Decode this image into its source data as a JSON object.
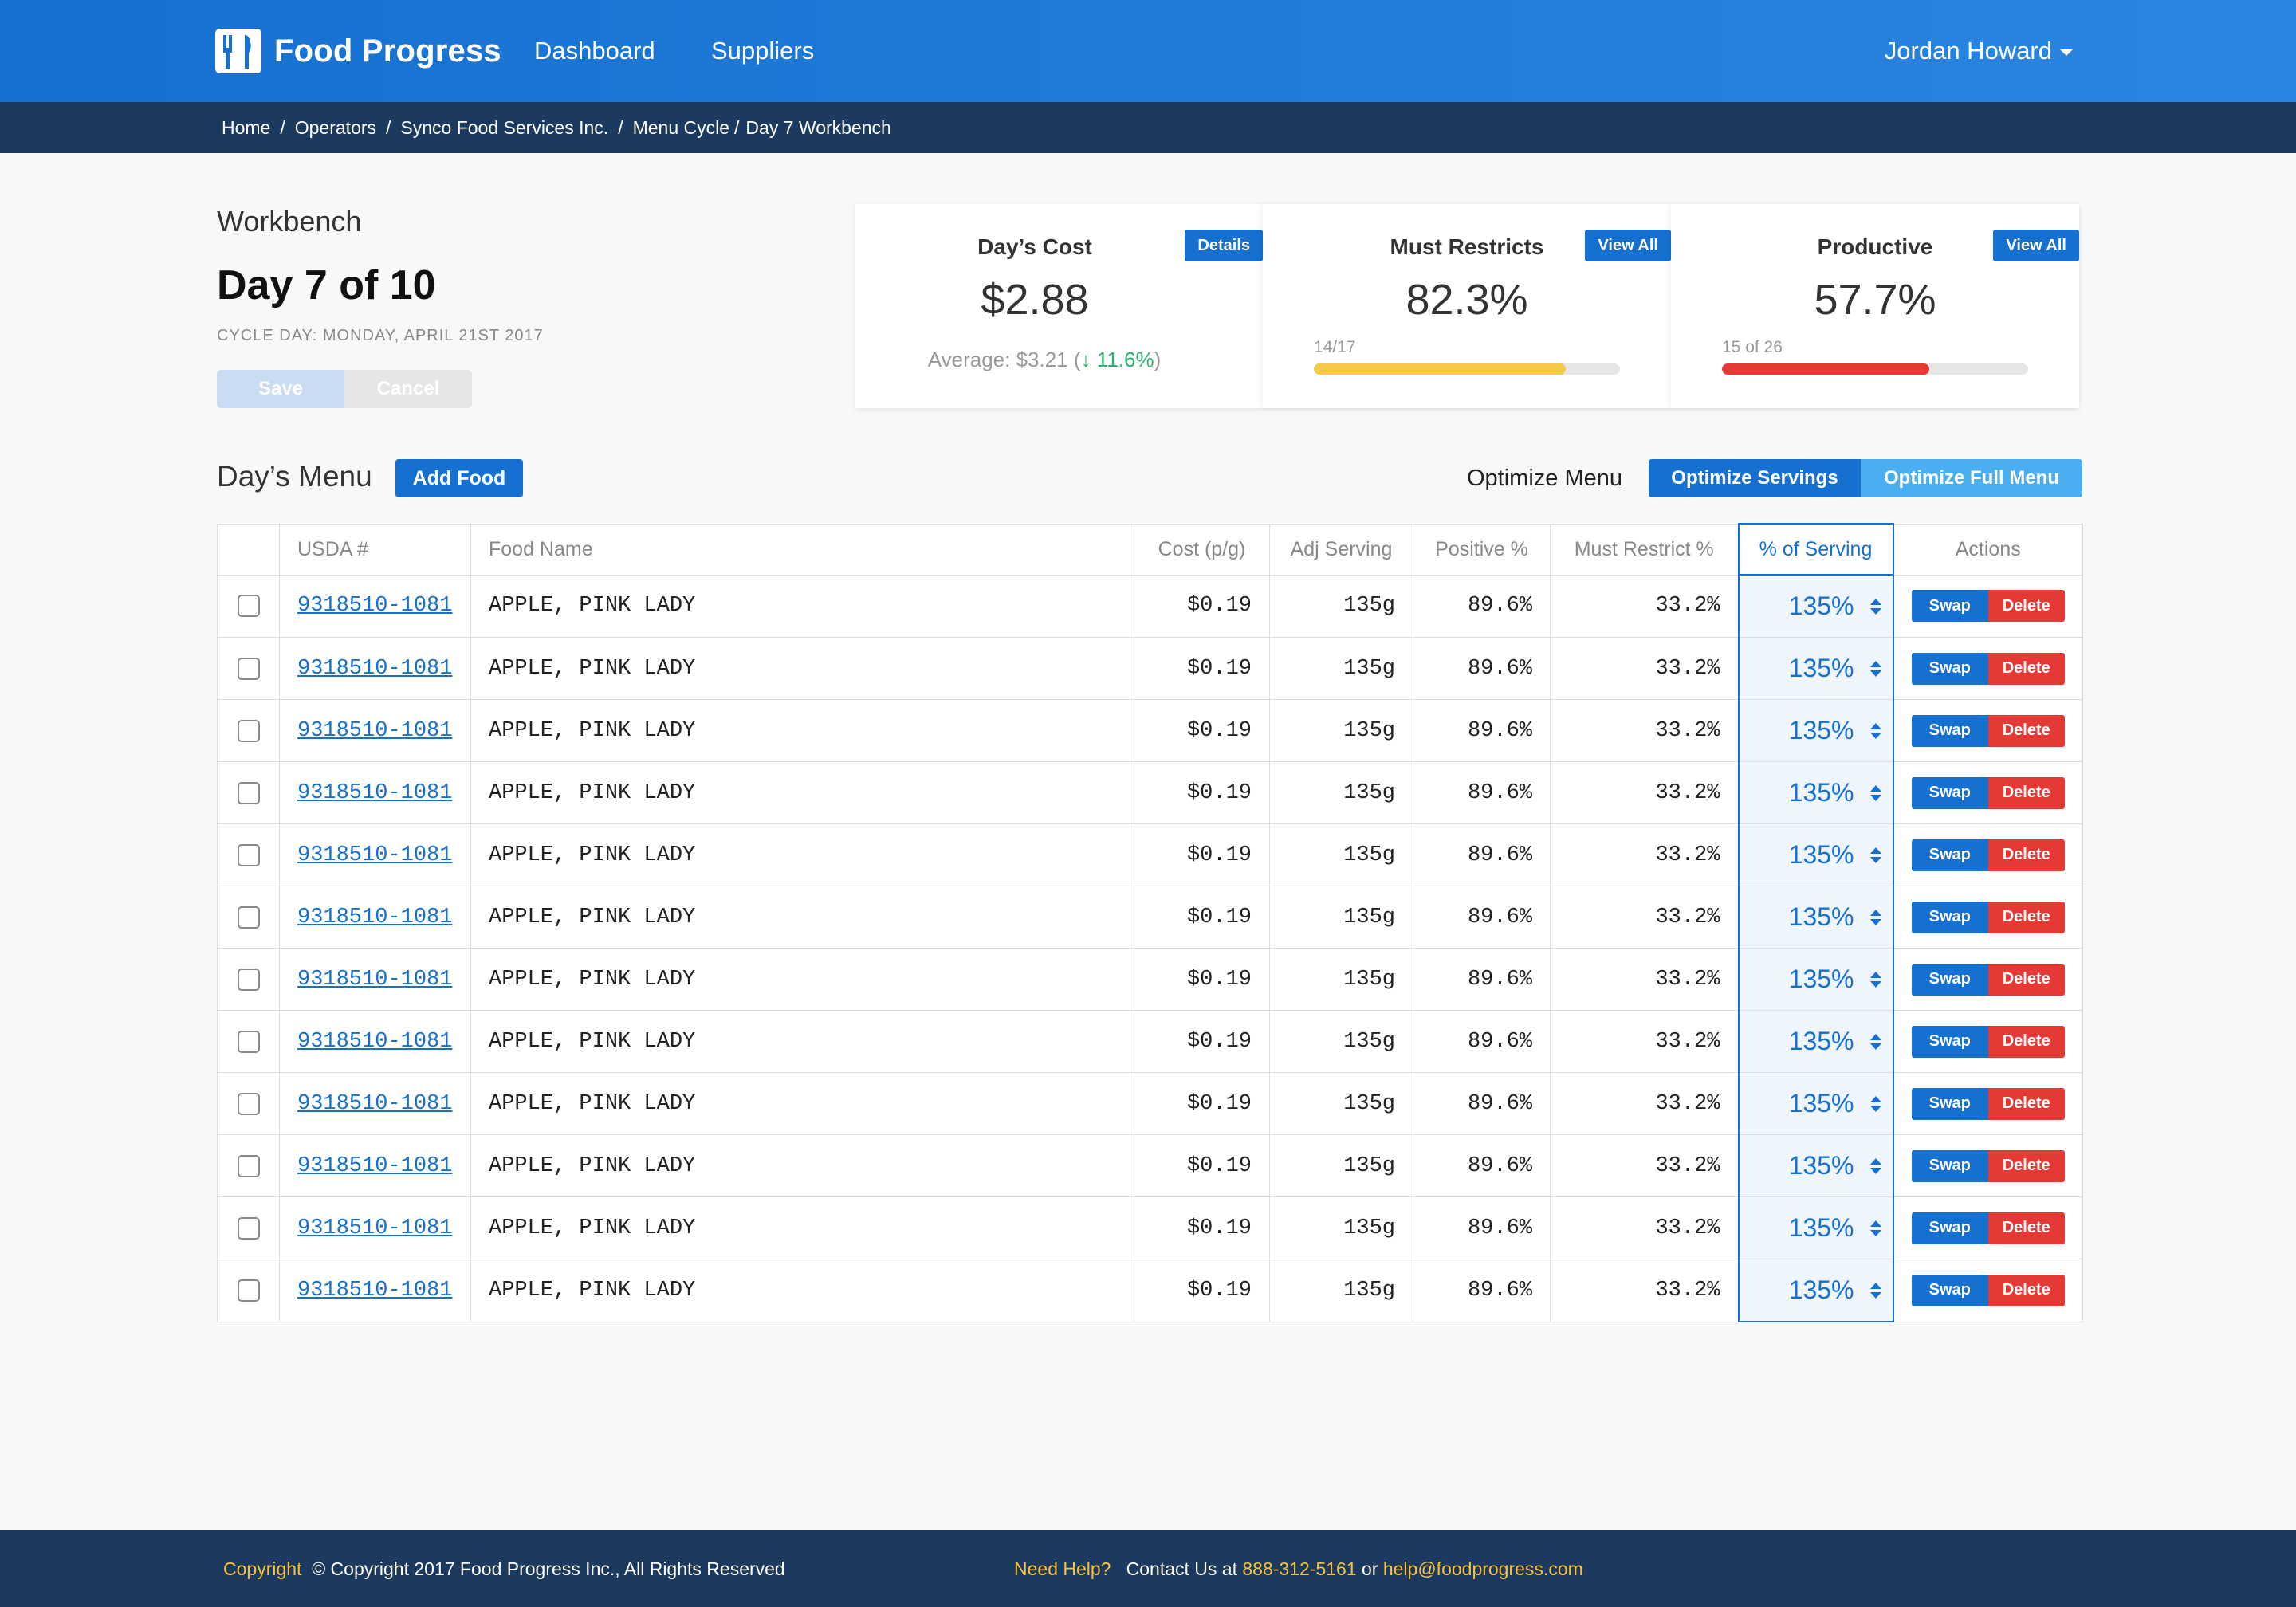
{
  "nav": {
    "brand": "Food Progress",
    "links": [
      "Dashboard",
      "Suppliers"
    ],
    "user": "Jordan Howard"
  },
  "breadcrumb": [
    "Home",
    "Operators",
    "Synco Food Services Inc.",
    "Menu Cycle",
    "Day 7 Workbench"
  ],
  "workbench": {
    "label": "Workbench",
    "title": "Day 7 of 10",
    "subtitle": "CYCLE DAY: MONDAY, APRIL 21ST 2017",
    "save": "Save",
    "cancel": "Cancel"
  },
  "cards": {
    "cost": {
      "title": "Day’s Cost",
      "value": "$2.88",
      "button": "Details",
      "avg_label": "Average:",
      "avg_value": "$3.21",
      "delta": "↓ 11.6%"
    },
    "restricts": {
      "title": "Must Restricts",
      "value": "82.3%",
      "button": "View All",
      "count": "14/17",
      "progress": 0.823,
      "color": "#f7c948"
    },
    "productive": {
      "title": "Productive",
      "value": "57.7%",
      "button": "View All",
      "count": "15 of 26",
      "progress": 0.677,
      "color": "#e53935"
    }
  },
  "menu": {
    "title": "Day’s Menu",
    "add": "Add Food",
    "optimize_label": "Optimize Menu",
    "opt_servings": "Optimize Servings",
    "opt_full": "Optimize Full Menu"
  },
  "table": {
    "headers": [
      "",
      "USDA #",
      "Food Name",
      "Cost (p/g)",
      "Adj Serving",
      "Positive %",
      "Must Restrict %",
      "% of Serving",
      "Actions"
    ],
    "swap": "Swap",
    "delete": "Delete",
    "rows": [
      {
        "usda": "9318510-1081",
        "name": "APPLE, PINK LADY",
        "cost": "$0.19",
        "serving": "135g",
        "positive": "89.6%",
        "restrict": "33.2%",
        "pct": "135%"
      },
      {
        "usda": "9318510-1081",
        "name": "APPLE, PINK LADY",
        "cost": "$0.19",
        "serving": "135g",
        "positive": "89.6%",
        "restrict": "33.2%",
        "pct": "135%"
      },
      {
        "usda": "9318510-1081",
        "name": "APPLE, PINK LADY",
        "cost": "$0.19",
        "serving": "135g",
        "positive": "89.6%",
        "restrict": "33.2%",
        "pct": "135%"
      },
      {
        "usda": "9318510-1081",
        "name": "APPLE, PINK LADY",
        "cost": "$0.19",
        "serving": "135g",
        "positive": "89.6%",
        "restrict": "33.2%",
        "pct": "135%"
      },
      {
        "usda": "9318510-1081",
        "name": "APPLE, PINK LADY",
        "cost": "$0.19",
        "serving": "135g",
        "positive": "89.6%",
        "restrict": "33.2%",
        "pct": "135%"
      },
      {
        "usda": "9318510-1081",
        "name": "APPLE, PINK LADY",
        "cost": "$0.19",
        "serving": "135g",
        "positive": "89.6%",
        "restrict": "33.2%",
        "pct": "135%"
      },
      {
        "usda": "9318510-1081",
        "name": "APPLE, PINK LADY",
        "cost": "$0.19",
        "serving": "135g",
        "positive": "89.6%",
        "restrict": "33.2%",
        "pct": "135%"
      },
      {
        "usda": "9318510-1081",
        "name": "APPLE, PINK LADY",
        "cost": "$0.19",
        "serving": "135g",
        "positive": "89.6%",
        "restrict": "33.2%",
        "pct": "135%"
      },
      {
        "usda": "9318510-1081",
        "name": "APPLE, PINK LADY",
        "cost": "$0.19",
        "serving": "135g",
        "positive": "89.6%",
        "restrict": "33.2%",
        "pct": "135%"
      },
      {
        "usda": "9318510-1081",
        "name": "APPLE, PINK LADY",
        "cost": "$0.19",
        "serving": "135g",
        "positive": "89.6%",
        "restrict": "33.2%",
        "pct": "135%"
      },
      {
        "usda": "9318510-1081",
        "name": "APPLE, PINK LADY",
        "cost": "$0.19",
        "serving": "135g",
        "positive": "89.6%",
        "restrict": "33.2%",
        "pct": "135%"
      },
      {
        "usda": "9318510-1081",
        "name": "APPLE, PINK LADY",
        "cost": "$0.19",
        "serving": "135g",
        "positive": "89.6%",
        "restrict": "33.2%",
        "pct": "135%"
      }
    ]
  },
  "footer": {
    "copyright_label": "Copyright",
    "copyright_text": "© Copyright 2017 Food Progress Inc., All Rights Reserved",
    "help_label": "Need Help?",
    "contact_prefix": "Contact Us at",
    "phone": "888-312-5161",
    "or": "or",
    "email": "help@foodprogress.com"
  },
  "colors": {
    "primary": "#1570d0",
    "danger": "#e53935",
    "warning": "#f7c948",
    "success": "#27b56b",
    "dark": "#1c3a60"
  }
}
